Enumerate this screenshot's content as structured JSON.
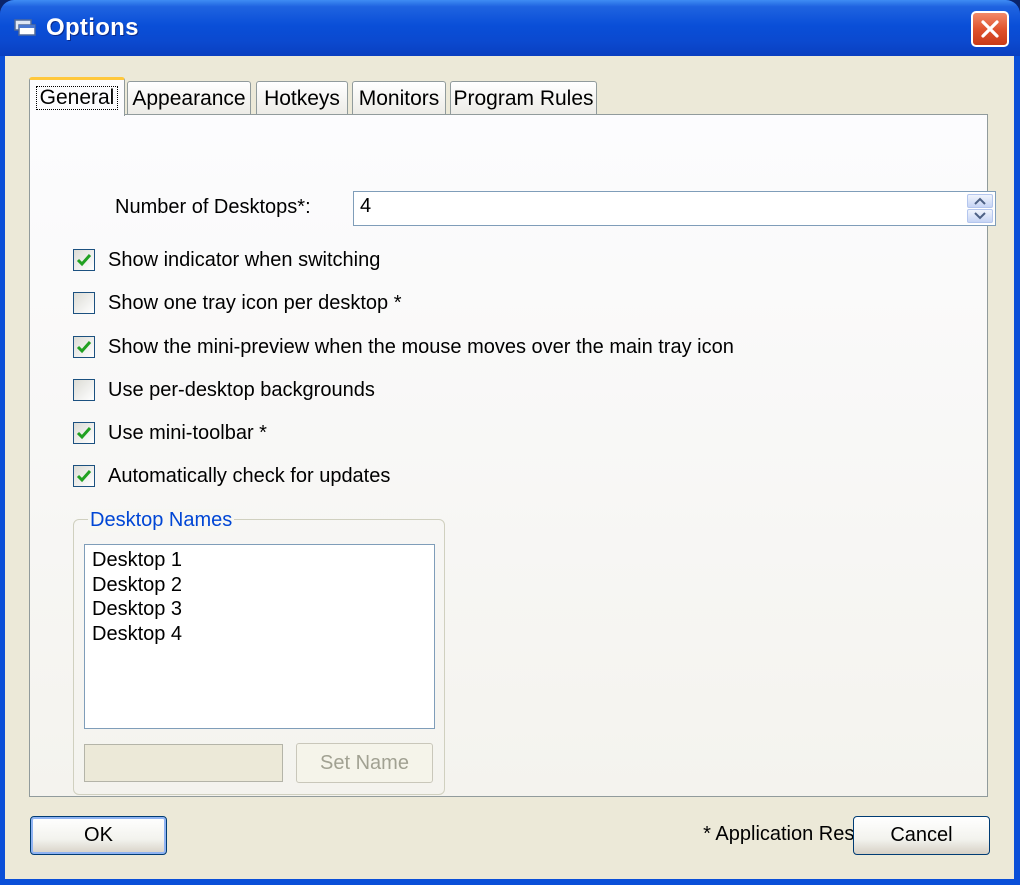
{
  "window": {
    "title": "Options",
    "icon": "app-icon",
    "close_icon": "close-icon"
  },
  "tabs": [
    {
      "label": "General",
      "active": true
    },
    {
      "label": "Appearance",
      "active": false
    },
    {
      "label": "Hotkeys",
      "active": false
    },
    {
      "label": "Monitors",
      "active": false
    },
    {
      "label": "Program Rules",
      "active": false
    }
  ],
  "general": {
    "desktops_label": "Number of Desktops*:",
    "desktops_value": "4",
    "checkboxes": [
      {
        "label": "Show indicator when switching",
        "checked": true
      },
      {
        "label": "Show one tray icon per desktop *",
        "checked": false
      },
      {
        "label": "Show the mini-preview when the mouse moves over the main tray icon",
        "checked": true
      },
      {
        "label": "Use per-desktop backgrounds",
        "checked": false
      },
      {
        "label": "Use mini-toolbar *",
        "checked": true
      },
      {
        "label": "Automatically check for updates",
        "checked": true
      }
    ],
    "desktop_names": {
      "legend": "Desktop Names",
      "items": [
        "Desktop 1",
        "Desktop 2",
        "Desktop 3",
        "Desktop 4"
      ],
      "name_value": "",
      "set_name_label": "Set Name"
    },
    "footnote": "* Application Restart Required"
  },
  "buttons": {
    "ok_label": "OK",
    "cancel_label": "Cancel"
  },
  "colors": {
    "titlebar": "#0a4fd8",
    "dialog_bg": "#ece9d8",
    "check_green": "#21a121",
    "group_legend": "#0046d5",
    "close_red": "#e0532e"
  }
}
